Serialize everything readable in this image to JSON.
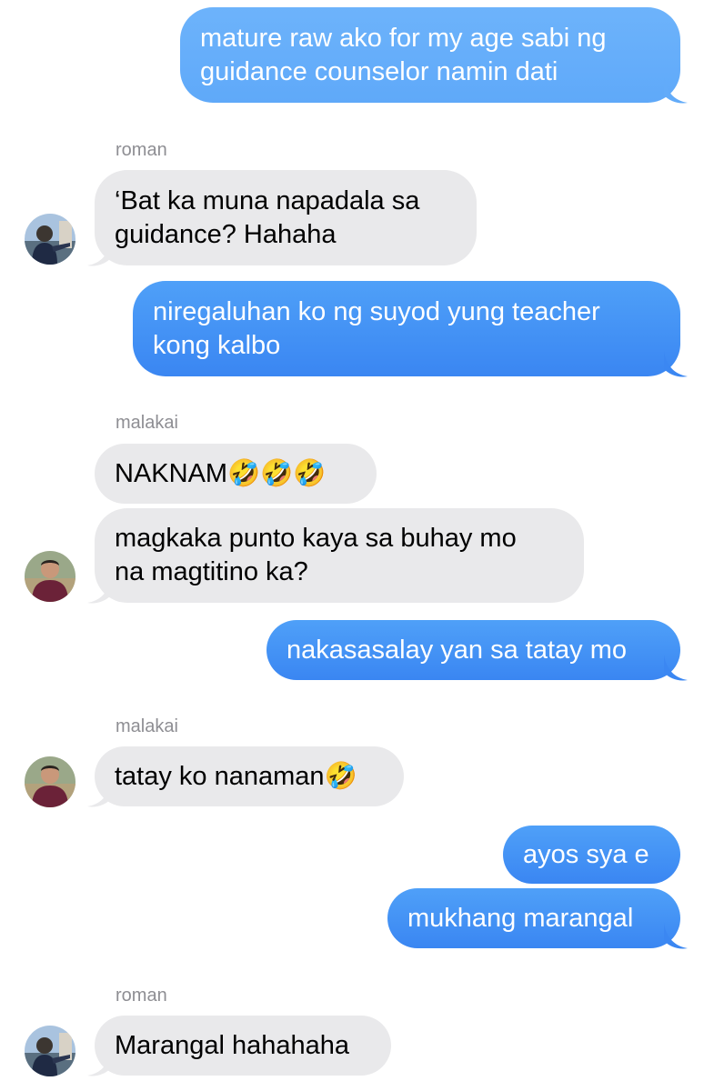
{
  "messages": [
    {
      "direction": "outgoing",
      "lines": [
        "mature raw ako for my age sabi ng",
        "guidance counselor namin dati"
      ]
    },
    {
      "direction": "incoming",
      "sender": "roman",
      "lines": [
        "‘Bat ka muna napadala sa",
        "guidance? Hahaha"
      ]
    },
    {
      "direction": "outgoing",
      "lines": [
        "niregaluhan ko ng suyod yung teacher",
        "kong kalbo"
      ]
    },
    {
      "direction": "incoming",
      "sender": "malakai",
      "lines": [
        "NAKNAM🤣🤣🤣"
      ]
    },
    {
      "direction": "incoming",
      "lines": [
        "magkaka punto kaya sa buhay mo",
        "na magtitino ka?"
      ]
    },
    {
      "direction": "outgoing",
      "lines": [
        "nakasasalay yan sa tatay mo"
      ]
    },
    {
      "direction": "incoming",
      "sender": "malakai",
      "lines": [
        "tatay ko nanaman🤣"
      ]
    },
    {
      "direction": "outgoing",
      "lines": [
        "ayos sya e"
      ]
    },
    {
      "direction": "outgoing",
      "lines": [
        "mukhang marangal"
      ]
    },
    {
      "direction": "incoming",
      "sender": "roman",
      "lines": [
        "Marangal hahahaha"
      ]
    }
  ],
  "avatars": {
    "roman": "avatar-roman",
    "malakai": "avatar-malakai"
  },
  "colors": {
    "outgoing_bubble": "#3a86f2",
    "incoming_bubble": "#e9e9eb",
    "sender_name": "#8e8e93"
  }
}
